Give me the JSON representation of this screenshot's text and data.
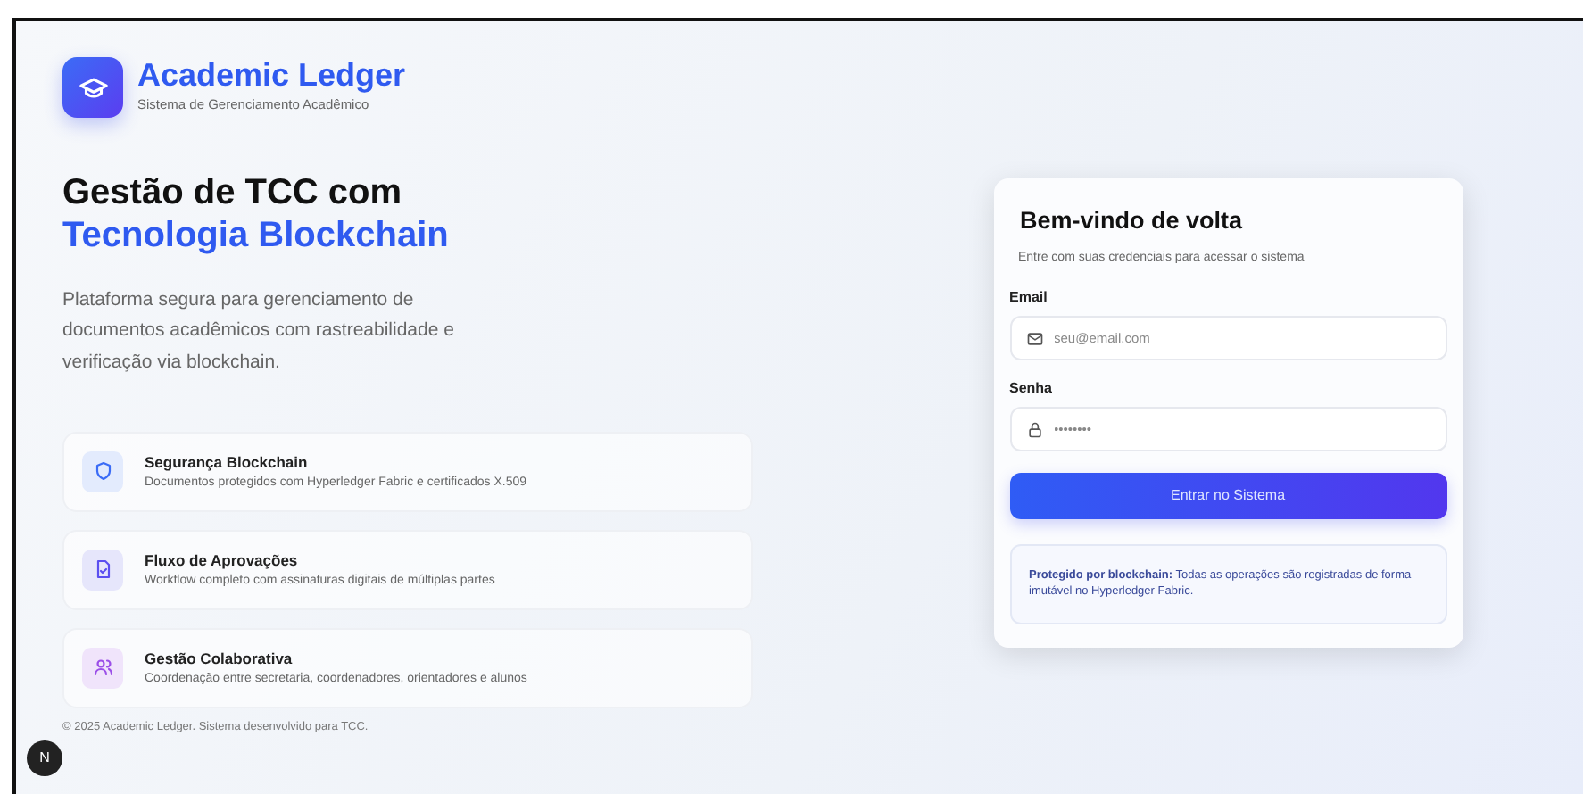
{
  "brand": {
    "name": "Academic Ledger",
    "tagline": "Sistema de Gerenciamento Acadêmico"
  },
  "hero": {
    "title_line_1": "Gestão de TCC com",
    "title_line_2": "Tecnologia Blockchain",
    "description": "Plataforma segura para gerenciamento de documentos acadêmicos com rastreabilidade e verificação via blockchain."
  },
  "features": [
    {
      "kind": "shield",
      "title": "Segurança Blockchain",
      "description": "Documentos protegidos com Hyperledger Fabric e certificados X.509"
    },
    {
      "kind": "document",
      "title": "Fluxo de Aprovações",
      "description": "Workflow completo com assinaturas digitais de múltiplas partes"
    },
    {
      "kind": "people",
      "title": "Gestão Colaborativa",
      "description": "Coordenação entre secretaria, coordenadores, orientadores e alunos"
    }
  ],
  "footer": "© 2025 Academic Ledger. Sistema desenvolvido para TCC.",
  "dev_badge": "N",
  "login": {
    "title": "Bem-vindo de volta",
    "subtitle": "Entre com suas credenciais para acessar o sistema",
    "fields": [
      {
        "kind": "email",
        "label": "Email",
        "placeholder": "seu@email.com"
      },
      {
        "kind": "password",
        "label": "Senha",
        "placeholder": "••••••••"
      }
    ],
    "submit": "Entrar no Sistema",
    "notice": "**Protegido por blockchain:** Todas as operações são registradas de forma imutável no Hyperledger Fabric."
  }
}
